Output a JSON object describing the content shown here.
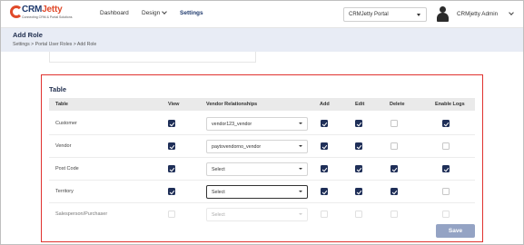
{
  "brand": {
    "logo_main": "CRM",
    "logo_accent": "Jetty",
    "tagline": "Connecting CRM & Portal Solutions"
  },
  "nav": {
    "dashboard": "Dashboard",
    "design": "Design",
    "settings": "Settings"
  },
  "portal_select": {
    "value": "CRMJetty Portal"
  },
  "user": {
    "name": "CRMjetty Admin"
  },
  "page": {
    "title": "Add Role",
    "breadcrumb": "Settings  >  Portal User Roles  >  Add Role"
  },
  "table_section": {
    "title": "Table",
    "columns": {
      "table": "Table",
      "view": "View",
      "vendor_relationships": "Vendor Relationships",
      "add": "Add",
      "edit": "Edit",
      "delete": "Delete",
      "enable_logs": "Enable Logs"
    },
    "rows": [
      {
        "name": "Customer",
        "view": true,
        "relationship": "vendor123_vendor",
        "add": true,
        "edit": true,
        "delete": false,
        "logs": true,
        "disabled": false
      },
      {
        "name": "Vendor",
        "view": true,
        "relationship": "paytovendorno_vendor",
        "add": true,
        "edit": true,
        "delete": false,
        "logs": false,
        "disabled": false
      },
      {
        "name": "Post Code",
        "view": true,
        "relationship": "Select",
        "add": true,
        "edit": true,
        "delete": true,
        "logs": true,
        "disabled": false
      },
      {
        "name": "Territory",
        "view": true,
        "relationship": "Select",
        "add": true,
        "edit": true,
        "delete": true,
        "logs": false,
        "disabled": false
      },
      {
        "name": "Salesperson/Purchaser",
        "view": false,
        "relationship": "Select",
        "add": false,
        "edit": false,
        "delete": false,
        "logs": false,
        "disabled": true
      }
    ],
    "save_label": "Save"
  },
  "colors": {
    "accent": "#1f2f58",
    "highlight_border": "#e0322f",
    "header_bg": "#e8ecf5",
    "save_button": "#94a3c4"
  }
}
